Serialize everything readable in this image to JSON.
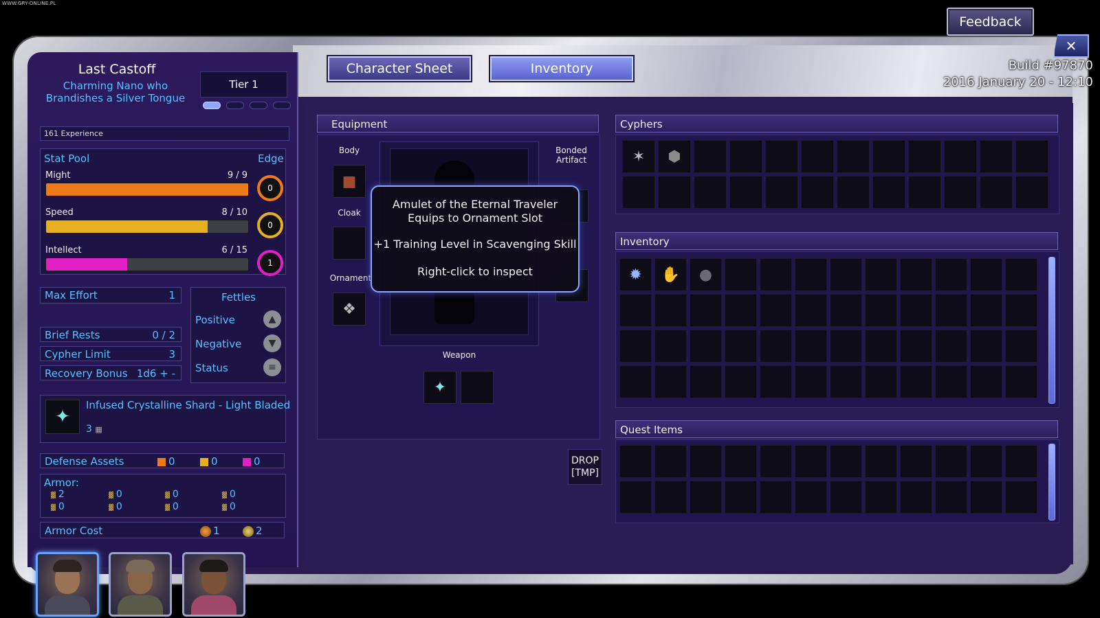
{
  "watermark": "WWW.GRY-ONLINE.PL",
  "top": {
    "feedback_label": "Feedback",
    "close_label": "✕",
    "build_line1": "Build #97870",
    "build_line2": "2016 January 20 - 12:10"
  },
  "tabs": [
    {
      "label": "Character Sheet"
    },
    {
      "label": "Inventory",
      "active": true
    }
  ],
  "character": {
    "name": "Last Castoff",
    "description": "Charming Nano who Brandishes a Silver Tongue",
    "tier": "Tier 1",
    "tier_pips": [
      true,
      false,
      false,
      false
    ],
    "experience": "161 Experience"
  },
  "stat_pool": {
    "title": "Stat Pool",
    "edge_title": "Edge",
    "stats": [
      {
        "name": "Might",
        "value": "9 / 9",
        "fraction": 1.0,
        "color": "#ef7a1a",
        "edge": "0"
      },
      {
        "name": "Speed",
        "value": "8 / 10",
        "fraction": 0.8,
        "color": "#e6b020",
        "edge": "0"
      },
      {
        "name": "Intellect",
        "value": "6 / 15",
        "fraction": 0.4,
        "color": "#e21fc4",
        "edge": "1"
      }
    ]
  },
  "attributes": [
    {
      "label": "Max Effort",
      "value": "1"
    },
    {
      "label": "Brief Rests",
      "value": "0 / 2"
    },
    {
      "label": "Cypher Limit",
      "value": "3"
    },
    {
      "label": "Recovery Bonus",
      "value": "1d6 + -"
    }
  ],
  "fettles": {
    "title": "Fettles",
    "items": [
      {
        "label": "Positive",
        "icon": "up-chevron-icon"
      },
      {
        "label": "Negative",
        "icon": "down-chevron-icon"
      },
      {
        "label": "Status",
        "icon": "equals-icon"
      }
    ]
  },
  "weapon": {
    "name": "Infused Crystalline Shard - Light Bladed",
    "damage": "3"
  },
  "defense": {
    "label": "Defense Assets",
    "values": [
      {
        "value": "0",
        "color": "#ef7a1a"
      },
      {
        "value": "0",
        "color": "#e6b020"
      },
      {
        "value": "0",
        "color": "#e21fc4"
      }
    ]
  },
  "armor": {
    "label": "Armor:",
    "values": [
      "2",
      "0",
      "0",
      "0",
      "0",
      "0",
      "0",
      "0"
    ]
  },
  "armor_cost": {
    "label": "Armor Cost",
    "values": [
      "1",
      "2"
    ]
  },
  "equipment": {
    "title": "Equipment",
    "body_label": "Body",
    "cloak_label": "Cloak",
    "ornament_label": "Ornament",
    "bonded_label": "Bonded Artifact",
    "weapon_label": "Weapon",
    "drop_line1": "DROP",
    "drop_line2": "[TMP]"
  },
  "cyphers": {
    "title": "Cyphers",
    "filled": 2,
    "columns": 12,
    "rows": 2
  },
  "inventory": {
    "title": "Inventory",
    "filled": 3,
    "columns": 12,
    "rows": 4
  },
  "quest_items": {
    "title": "Quest Items",
    "columns": 12,
    "rows": 2
  },
  "tooltip": {
    "line1": "Amulet of the Eternal Traveler",
    "line2": "Equips to Ornament Slot",
    "line3": "+1 Training Level in Scavenging Skill",
    "line4": "Right-click to inspect"
  }
}
